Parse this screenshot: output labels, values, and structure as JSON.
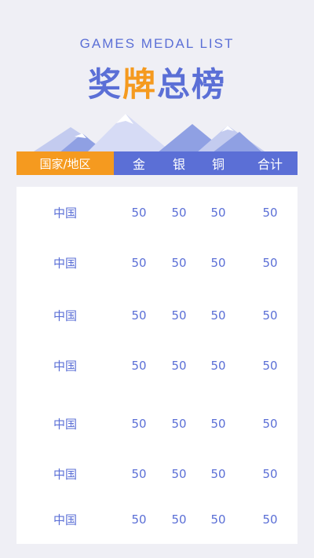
{
  "subtitle": "GAMES MEDAL LIST",
  "title": {
    "part1": "奖",
    "part2": "牌",
    "part3": "总榜"
  },
  "colors": {
    "blue": "#5b6fd6",
    "orange": "#f59a1f",
    "background": "#efeff5"
  },
  "header": {
    "country": "国家/地区",
    "gold": "金",
    "silver": "银",
    "bronze": "铜",
    "total": "合计"
  },
  "rows": [
    {
      "country": "中国",
      "gold": "50",
      "silver": "50",
      "bronze": "50",
      "total": "50"
    },
    {
      "country": "中国",
      "gold": "50",
      "silver": "50",
      "bronze": "50",
      "total": "50"
    },
    {
      "country": "中国",
      "gold": "50",
      "silver": "50",
      "bronze": "50",
      "total": "50"
    },
    {
      "country": "中国",
      "gold": "50",
      "silver": "50",
      "bronze": "50",
      "total": "50"
    },
    {
      "country": "中国",
      "gold": "50",
      "silver": "50",
      "bronze": "50",
      "total": "50"
    },
    {
      "country": "中国",
      "gold": "50",
      "silver": "50",
      "bronze": "50",
      "total": "50"
    },
    {
      "country": "中国",
      "gold": "50",
      "silver": "50",
      "bronze": "50",
      "total": "50"
    }
  ]
}
